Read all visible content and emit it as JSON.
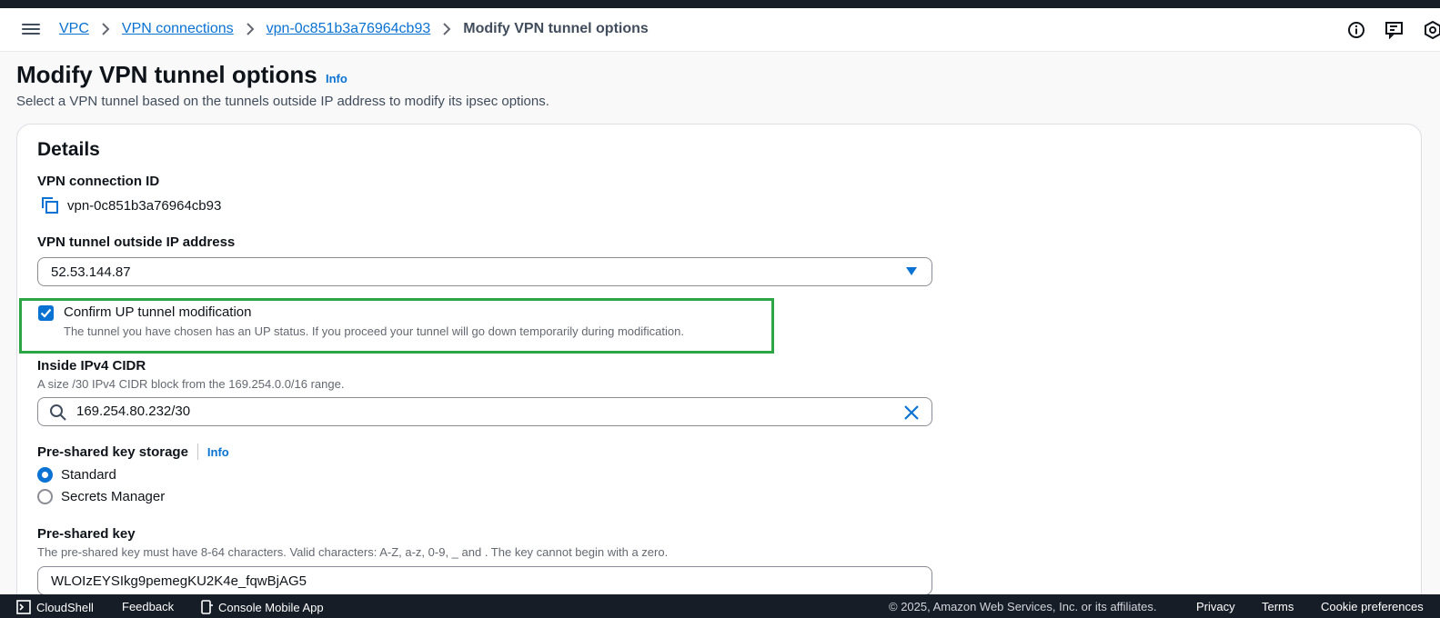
{
  "breadcrumb": {
    "items": [
      "VPC",
      "VPN connections",
      "vpn-0c851b3a76964cb93"
    ],
    "current": "Modify VPN tunnel options"
  },
  "header": {
    "title": "Modify VPN tunnel options",
    "info_label": "Info",
    "description": "Select a VPN tunnel based on the tunnels outside IP address to modify its ipsec options."
  },
  "details": {
    "title": "Details",
    "vpn_connection_id_label": "VPN connection ID",
    "vpn_connection_id": "vpn-0c851b3a76964cb93",
    "outside_ip_label": "VPN tunnel outside IP address",
    "outside_ip_value": "52.53.144.87",
    "confirm_label": "Confirm UP tunnel modification",
    "confirm_description": "The tunnel you have chosen has an UP status. If you proceed your tunnel will go down temporarily during modification.",
    "confirm_checked": true,
    "inside_cidr_label": "Inside IPv4 CIDR",
    "inside_cidr_description": "A size /30 IPv4 CIDR block from the 169.254.0.0/16 range.",
    "inside_cidr_value": "169.254.80.232/30",
    "psk_storage_label": "Pre-shared key storage",
    "psk_storage_info": "Info",
    "psk_storage_options": [
      "Standard",
      "Secrets Manager"
    ],
    "psk_storage_selected": "Standard",
    "psk_label": "Pre-shared key",
    "psk_description": "The pre-shared key must have 8-64 characters. Valid characters: A-Z, a-z, 0-9, _ and . The key cannot begin with a zero.",
    "psk_value": "WLOIzEYSIkg9pemegKU2K4e_fqwBjAG5"
  },
  "footer": {
    "cloudshell": "CloudShell",
    "feedback": "Feedback",
    "mobile_app": "Console Mobile App",
    "copyright": "© 2025, Amazon Web Services, Inc. or its affiliates.",
    "privacy": "Privacy",
    "terms": "Terms",
    "cookie": "Cookie preferences"
  },
  "colors": {
    "accent": "#0972d3",
    "highlight": "#2ca544",
    "footer_bg": "#161d26"
  }
}
